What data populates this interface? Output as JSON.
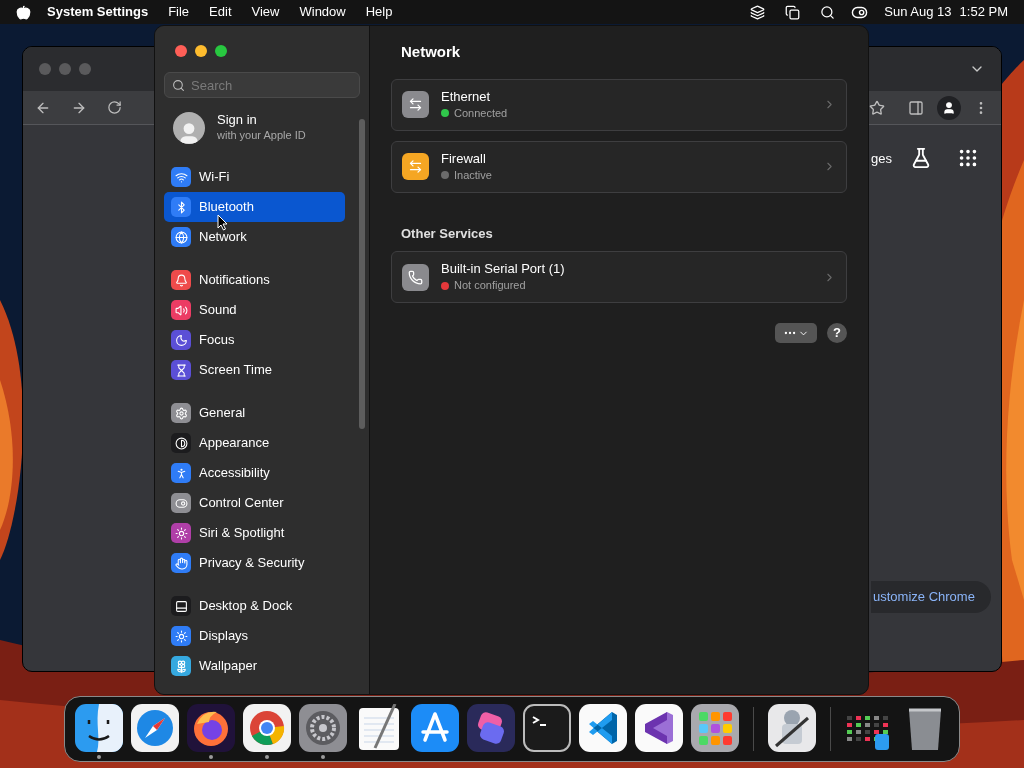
{
  "menu_bar": {
    "app_name": "System Settings",
    "menus": [
      "File",
      "Edit",
      "View",
      "Window",
      "Help"
    ],
    "date": "Sun Aug 13",
    "time": "1:52 PM"
  },
  "browser": {
    "partial_link": "ges",
    "customize_button": "ustomize Chrome"
  },
  "settings": {
    "search": {
      "placeholder": "Search"
    },
    "account": {
      "title": "Sign in",
      "subtitle": "with your Apple ID"
    },
    "sidebar_groups": [
      [
        {
          "label": "Wi-Fi",
          "kind": "wifi",
          "color": "#2f7cf6",
          "selected": false
        },
        {
          "label": "Bluetooth",
          "kind": "bluetooth",
          "color": "#2f7cf6",
          "selected": true
        },
        {
          "label": "Network",
          "kind": "network",
          "color": "#2f7cf6",
          "selected": false
        }
      ],
      [
        {
          "label": "Notifications",
          "kind": "notifications",
          "color": "#ef4b4b",
          "selected": false
        },
        {
          "label": "Sound",
          "kind": "sound",
          "color": "#ec3c64",
          "selected": false
        },
        {
          "label": "Focus",
          "kind": "focus",
          "color": "#5b4fd6",
          "selected": false
        },
        {
          "label": "Screen Time",
          "kind": "screen_time",
          "color": "#5b4fd6",
          "selected": false
        }
      ],
      [
        {
          "label": "General",
          "kind": "general",
          "color": "#8e8e93",
          "selected": false
        },
        {
          "label": "Appearance",
          "kind": "appearance",
          "color": "#1c1c1e",
          "selected": false
        },
        {
          "label": "Accessibility",
          "kind": "accessibility",
          "color": "#2f7cf6",
          "selected": false
        },
        {
          "label": "Control Center",
          "kind": "control_center",
          "color": "#8e8e93",
          "selected": false
        },
        {
          "label": "Siri & Spotlight",
          "kind": "siri",
          "color": "#b03fa8",
          "selected": false
        },
        {
          "label": "Privacy & Security",
          "kind": "privacy",
          "color": "#2f7cf6",
          "selected": false
        }
      ],
      [
        {
          "label": "Desktop & Dock",
          "kind": "desktop",
          "color": "#1c1c1e",
          "selected": false
        },
        {
          "label": "Displays",
          "kind": "displays",
          "color": "#2f7cf6",
          "selected": false
        },
        {
          "label": "Wallpaper",
          "kind": "wallpaper",
          "color": "#36a9e0",
          "selected": false
        }
      ]
    ],
    "title": "Network",
    "services": [
      {
        "name": "Ethernet",
        "status": "Connected",
        "color": "#30c74b",
        "kind": "ethernet"
      },
      {
        "name": "Firewall",
        "status": "Inactive",
        "color": "#6b6b6b",
        "kind": "firewall"
      }
    ],
    "other_title": "Other Services",
    "other_services": [
      {
        "name": "Built-in Serial Port (1)",
        "status": "Not configured",
        "color": "#e5383b",
        "kind": "serial"
      }
    ],
    "help": "?"
  },
  "dock": [
    [
      {
        "kind": "finder",
        "running": true
      },
      {
        "kind": "safari",
        "running": false
      },
      {
        "kind": "firefox",
        "running": true
      },
      {
        "kind": "chrome",
        "running": true
      },
      {
        "kind": "settings",
        "running": true
      },
      {
        "kind": "textedit",
        "running": false
      },
      {
        "kind": "appstore",
        "running": false
      },
      {
        "kind": "shortcuts",
        "running": false
      },
      {
        "kind": "terminal",
        "running": false
      },
      {
        "kind": "vscode",
        "running": false
      },
      {
        "kind": "visualstudio",
        "running": false
      },
      {
        "kind": "launchpad",
        "running": false
      }
    ],
    [
      {
        "kind": "automator",
        "running": false
      }
    ],
    [
      {
        "kind": "downloads",
        "running": false
      },
      {
        "kind": "trash",
        "running": false
      }
    ]
  ]
}
